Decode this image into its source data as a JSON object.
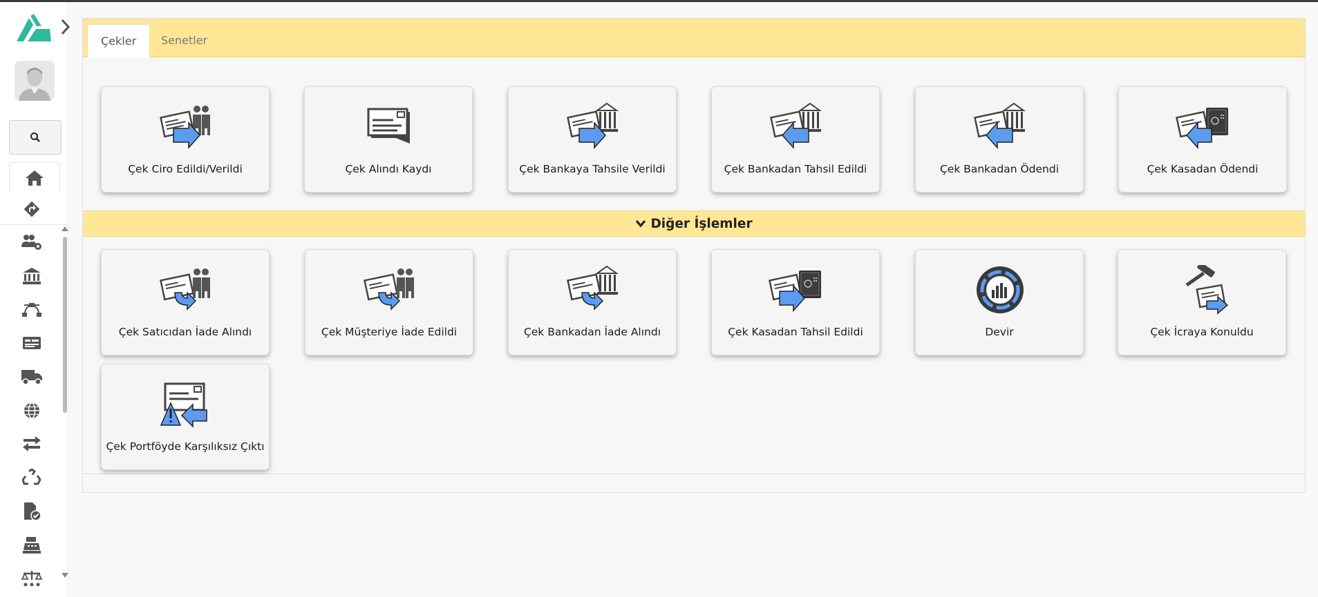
{
  "colors": {
    "accent": "#2fb9a0",
    "tab_bar": "#ffe795",
    "icon_blue": "#5b9cf0",
    "icon_dark": "#444444"
  },
  "sidebar": {
    "logo": "brand-logo",
    "nav_icons": [
      "home-icon",
      "share-arrow-icon",
      "users-gear-icon",
      "bank-icon",
      "vector-nodes-icon",
      "id-card-icon",
      "truck-icon",
      "globe-icon",
      "transfer-arrows-icon",
      "recycle-icon",
      "file-check-icon",
      "cash-register-icon",
      "scales-icon"
    ]
  },
  "tabs": [
    {
      "label": "Çekler",
      "active": true
    },
    {
      "label": "Senetler",
      "active": false
    }
  ],
  "primary_actions": [
    {
      "label": "Çek Ciro Edildi/Verildi",
      "icon": "check-to-people-icon"
    },
    {
      "label": "Çek Alındı Kaydı",
      "icon": "check-received-icon"
    },
    {
      "label": "Çek Bankaya Tahsile Verildi",
      "icon": "check-to-bank-icon"
    },
    {
      "label": "Çek Bankadan Tahsil Edildi",
      "icon": "check-from-bank-icon"
    },
    {
      "label": "Çek Bankadan Ödendi",
      "icon": "check-paid-bank-icon"
    },
    {
      "label": "Çek Kasadan Ödendi",
      "icon": "check-paid-safe-icon"
    }
  ],
  "section": {
    "title": "Diğer İşlemler"
  },
  "other_actions": [
    {
      "label": "Çek Satıcıdan İade Alındı",
      "icon": "check-return-people-icon"
    },
    {
      "label": "Çek Müşteriye İade Edildi",
      "icon": "check-return-customer-icon"
    },
    {
      "label": "Çek Bankadan İade Alındı",
      "icon": "check-return-bank-icon"
    },
    {
      "label": "Çek Kasadan Tahsil Edildi",
      "icon": "check-safe-collect-icon"
    },
    {
      "label": "Devir",
      "icon": "transfer-chart-icon"
    },
    {
      "label": "Çek İcraya Konuldu",
      "icon": "check-gavel-icon"
    },
    {
      "label": "Çek Portföyde Karşılıksız Çıktı",
      "icon": "check-bounced-icon"
    }
  ]
}
